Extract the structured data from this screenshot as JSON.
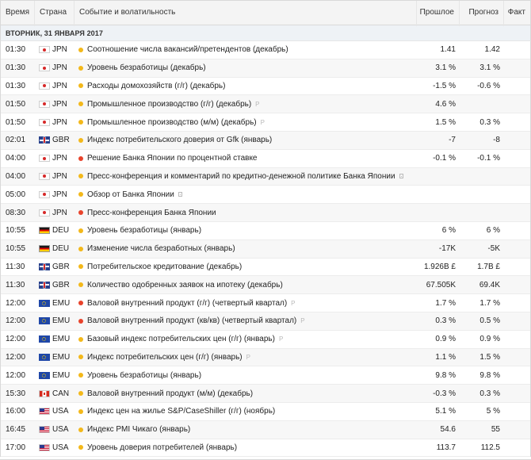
{
  "header": {
    "time": "Время",
    "country": "Страна",
    "event": "Событие и волатильность",
    "previous": "Прошлое",
    "forecast": "Прогноз",
    "fact": "Факт"
  },
  "date_label": "ВТОРНИК, 31 ЯНВАРЯ 2017",
  "colors": {
    "medium": "#f3b81a",
    "high": "#e8432b"
  },
  "events": [
    {
      "time": "01:30",
      "country": "JPN",
      "flag": "jpn-flag-icon",
      "vol": "medium",
      "event": "Соотношение числа вакансий/претендентов (декабрь)",
      "icon": "",
      "prev": "1.41",
      "fc": "1.42",
      "fact": ""
    },
    {
      "time": "01:30",
      "country": "JPN",
      "flag": "jpn-flag-icon",
      "vol": "medium",
      "event": "Уровень безработицы (декабрь)",
      "icon": "",
      "prev": "3.1 %",
      "fc": "3.1 %",
      "fact": ""
    },
    {
      "time": "01:30",
      "country": "JPN",
      "flag": "jpn-flag-icon",
      "vol": "medium",
      "event": "Расходы домохозяйств (г/г) (декабрь)",
      "icon": "",
      "prev": "-1.5 %",
      "fc": "-0.6 %",
      "fact": ""
    },
    {
      "time": "01:50",
      "country": "JPN",
      "flag": "jpn-flag-icon",
      "vol": "medium",
      "event": "Промышленное производство (г/г) (декабрь)",
      "icon": "P",
      "prev": "4.6 %",
      "fc": "",
      "fact": ""
    },
    {
      "time": "01:50",
      "country": "JPN",
      "flag": "jpn-flag-icon",
      "vol": "medium",
      "event": "Промышленное производство (м/м) (декабрь)",
      "icon": "P",
      "prev": "1.5 %",
      "fc": "0.3 %",
      "fact": ""
    },
    {
      "time": "02:01",
      "country": "GBR",
      "flag": "gbr-flag-icon",
      "vol": "medium",
      "event": "Индекс потребительского доверия от Gfk (январь)",
      "icon": "",
      "prev": "-7",
      "fc": "-8",
      "fact": ""
    },
    {
      "time": "04:00",
      "country": "JPN",
      "flag": "jpn-flag-icon",
      "vol": "high",
      "event": "Решение Банка Японии по процентной ставке",
      "icon": "",
      "prev": "-0.1 %",
      "fc": "-0.1 %",
      "fact": ""
    },
    {
      "time": "04:00",
      "country": "JPN",
      "flag": "jpn-flag-icon",
      "vol": "medium",
      "event": "Пресс-конференция и комментарий по кредитно-денежной политике Банка Японии",
      "icon": "doc",
      "prev": "",
      "fc": "",
      "fact": ""
    },
    {
      "time": "05:00",
      "country": "JPN",
      "flag": "jpn-flag-icon",
      "vol": "medium",
      "event": "Обзор от Банка Японии",
      "icon": "doc",
      "prev": "",
      "fc": "",
      "fact": ""
    },
    {
      "time": "08:30",
      "country": "JPN",
      "flag": "jpn-flag-icon",
      "vol": "high",
      "event": "Пресс-конференция Банка Японии",
      "icon": "",
      "prev": "",
      "fc": "",
      "fact": ""
    },
    {
      "time": "10:55",
      "country": "DEU",
      "flag": "deu-flag-icon",
      "vol": "medium",
      "event": "Уровень безработицы (январь)",
      "icon": "",
      "prev": "6 %",
      "fc": "6 %",
      "fact": ""
    },
    {
      "time": "10:55",
      "country": "DEU",
      "flag": "deu-flag-icon",
      "vol": "medium",
      "event": "Изменение числа безработных (январь)",
      "icon": "",
      "prev": "-17K",
      "fc": "-5K",
      "fact": ""
    },
    {
      "time": "11:30",
      "country": "GBR",
      "flag": "gbr-flag-icon",
      "vol": "medium",
      "event": "Потребительское кредитование (декабрь)",
      "icon": "",
      "prev": "1.926B £",
      "fc": "1.7B £",
      "fact": ""
    },
    {
      "time": "11:30",
      "country": "GBR",
      "flag": "gbr-flag-icon",
      "vol": "medium",
      "event": "Количество одобренных заявок на ипотеку (декабрь)",
      "icon": "",
      "prev": "67.505K",
      "fc": "69.4K",
      "fact": ""
    },
    {
      "time": "12:00",
      "country": "EMU",
      "flag": "emu-flag-icon",
      "vol": "high",
      "event": "Валовой внутренний продукт (г/г) (четвертый квартал)",
      "icon": "P",
      "prev": "1.7 %",
      "fc": "1.7 %",
      "fact": ""
    },
    {
      "time": "12:00",
      "country": "EMU",
      "flag": "emu-flag-icon",
      "vol": "high",
      "event": "Валовой внутренний продукт (кв/кв) (четвертый квартал)",
      "icon": "P",
      "prev": "0.3 %",
      "fc": "0.5 %",
      "fact": ""
    },
    {
      "time": "12:00",
      "country": "EMU",
      "flag": "emu-flag-icon",
      "vol": "medium",
      "event": "Базовый индекс потребительских цен (г/г) (январь)",
      "icon": "P",
      "prev": "0.9 %",
      "fc": "0.9 %",
      "fact": ""
    },
    {
      "time": "12:00",
      "country": "EMU",
      "flag": "emu-flag-icon",
      "vol": "medium",
      "event": "Индекс потребительских цен (г/г) (январь)",
      "icon": "P",
      "prev": "1.1 %",
      "fc": "1.5 %",
      "fact": ""
    },
    {
      "time": "12:00",
      "country": "EMU",
      "flag": "emu-flag-icon",
      "vol": "medium",
      "event": "Уровень безработицы (январь)",
      "icon": "",
      "prev": "9.8 %",
      "fc": "9.8 %",
      "fact": ""
    },
    {
      "time": "15:30",
      "country": "CAN",
      "flag": "can-flag-icon",
      "vol": "medium",
      "event": "Валовой внутренний продукт (м/м) (декабрь)",
      "icon": "",
      "prev": "-0.3 %",
      "fc": "0.3 %",
      "fact": ""
    },
    {
      "time": "16:00",
      "country": "USA",
      "flag": "usa-flag-icon",
      "vol": "medium",
      "event": "Индекс цен на жилье S&P/CaseShiller (г/г) (ноябрь)",
      "icon": "",
      "prev": "5.1 %",
      "fc": "5 %",
      "fact": ""
    },
    {
      "time": "16:45",
      "country": "USA",
      "flag": "usa-flag-icon",
      "vol": "medium",
      "event": "Индекс PMI Чикаго (январь)",
      "icon": "",
      "prev": "54.6",
      "fc": "55",
      "fact": ""
    },
    {
      "time": "17:00",
      "country": "USA",
      "flag": "usa-flag-icon",
      "vol": "medium",
      "event": "Уровень доверия потребителей (январь)",
      "icon": "",
      "prev": "113.7",
      "fc": "112.5",
      "fact": ""
    }
  ]
}
